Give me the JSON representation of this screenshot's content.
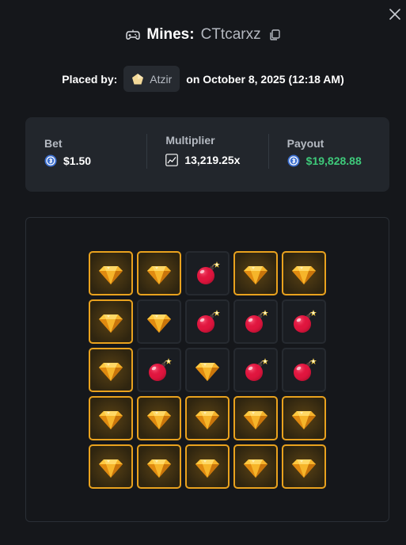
{
  "header": {
    "game_name": "Mines:",
    "bet_id": "CTtcarxz",
    "icons": {
      "game": "gamepad-icon",
      "copy": "copy-icon",
      "close": "close-icon"
    }
  },
  "placed": {
    "label": "Placed by:",
    "user": "Atzir",
    "user_icon": "pentagon-rank-icon",
    "date_text": "on October 8, 2025 (12:18 AM)"
  },
  "stats": {
    "bet": {
      "label": "Bet",
      "value": "$1.50",
      "icon": "coin-icon"
    },
    "multiplier": {
      "label": "Multiplier",
      "value": "13,219.25x",
      "icon": "chart-icon"
    },
    "payout": {
      "label": "Payout",
      "value": "$19,828.88",
      "icon": "coin-icon"
    }
  },
  "colors": {
    "background": "#15171b",
    "panel": "#22262c",
    "payout_green": "#3ec97a",
    "gem_border": "#e9a21e"
  },
  "board": {
    "legend": {
      "g": "gem selected",
      "d": "gem unselected",
      "b": "mine"
    },
    "rows": [
      [
        "g",
        "g",
        "b",
        "g",
        "g"
      ],
      [
        "g",
        "d",
        "b",
        "b",
        "b"
      ],
      [
        "g",
        "b",
        "d",
        "b",
        "b"
      ],
      [
        "g",
        "g",
        "g",
        "g",
        "g"
      ],
      [
        "g",
        "g",
        "g",
        "g",
        "g"
      ]
    ]
  }
}
